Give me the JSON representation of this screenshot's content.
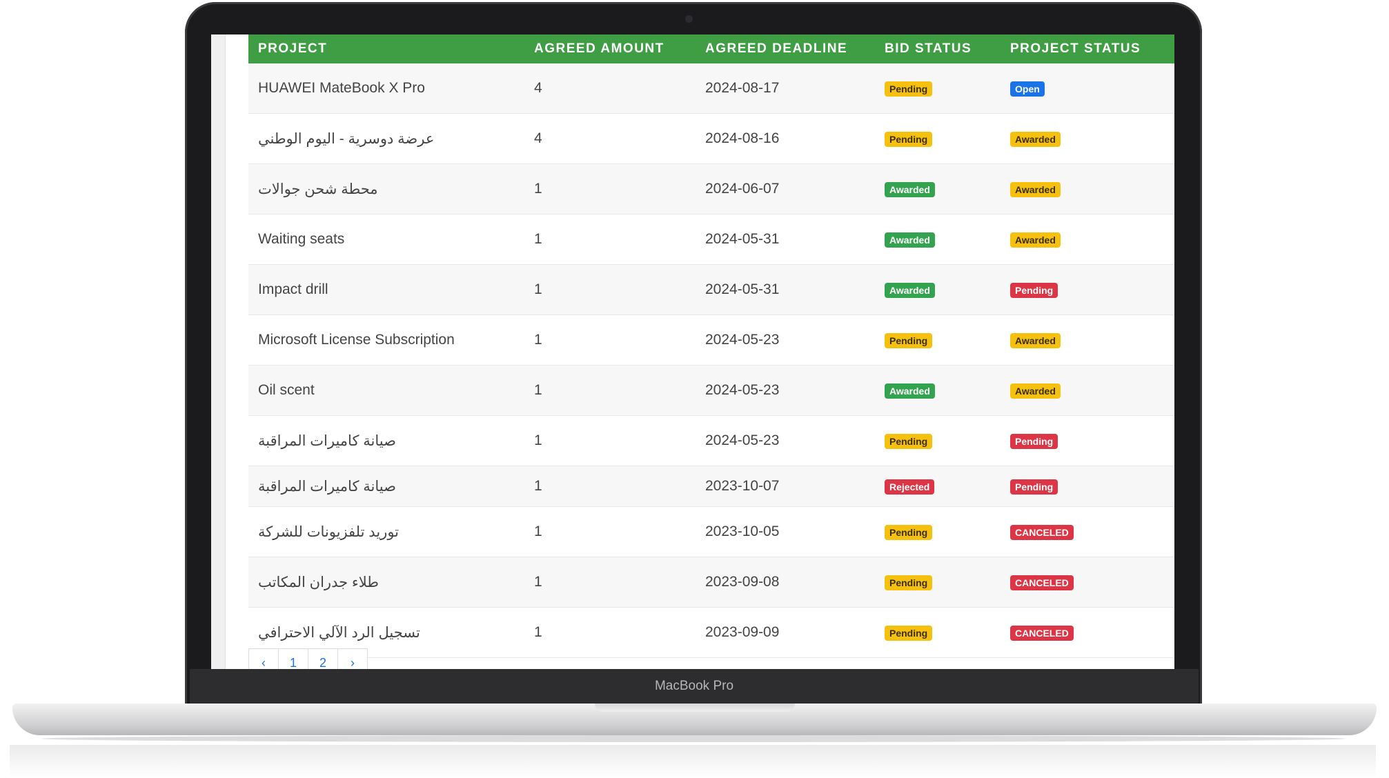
{
  "table": {
    "headers": [
      "PROJECT",
      "AGREED AMOUNT",
      "AGREED DEADLINE",
      "BID STATUS",
      "PROJECT STATUS"
    ],
    "rows": [
      {
        "project": "HUAWEI MateBook X Pro",
        "amount": "4",
        "deadline": "2024-08-17",
        "bid": "Pending",
        "bid_style": "pending-y",
        "status": "Open",
        "status_style": "open-b"
      },
      {
        "project": "عرضة دوسرية - اليوم الوطني",
        "amount": "4",
        "deadline": "2024-08-16",
        "bid": "Pending",
        "bid_style": "pending-y",
        "status": "Awarded",
        "status_style": "awarded-y"
      },
      {
        "project": "محطة شحن جوالات",
        "amount": "1",
        "deadline": "2024-06-07",
        "bid": "Awarded",
        "bid_style": "awarded-g",
        "status": "Awarded",
        "status_style": "awarded-y"
      },
      {
        "project": "Waiting seats",
        "amount": "1",
        "deadline": "2024-05-31",
        "bid": "Awarded",
        "bid_style": "awarded-g",
        "status": "Awarded",
        "status_style": "awarded-y"
      },
      {
        "project": "Impact drill",
        "amount": "1",
        "deadline": "2024-05-31",
        "bid": "Awarded",
        "bid_style": "awarded-g",
        "status": "Pending",
        "status_style": "pending-r"
      },
      {
        "project": "Microsoft License Subscription",
        "amount": "1",
        "deadline": "2024-05-23",
        "bid": "Pending",
        "bid_style": "pending-y",
        "status": "Awarded",
        "status_style": "awarded-y"
      },
      {
        "project": "Oil scent",
        "amount": "1",
        "deadline": "2024-05-23",
        "bid": "Awarded",
        "bid_style": "awarded-g",
        "status": "Awarded",
        "status_style": "awarded-y"
      },
      {
        "project": "صيانة كاميرات المراقبة",
        "amount": "1",
        "deadline": "2024-05-23",
        "bid": "Pending",
        "bid_style": "pending-y",
        "status": "Pending",
        "status_style": "pending-r"
      },
      {
        "project": "صيانة كاميرات المراقبة",
        "amount": "1",
        "deadline": "2023-10-07",
        "bid": "Rejected",
        "bid_style": "rejected-r",
        "status": "Pending",
        "status_style": "pending-r"
      },
      {
        "project": "توريد تلفزيونات للشركة",
        "amount": "1",
        "deadline": "2023-10-05",
        "bid": "Pending",
        "bid_style": "pending-y",
        "status": "CANCELED",
        "status_style": "canceled-r"
      },
      {
        "project": "طلاء جدران المكاتب",
        "amount": "1",
        "deadline": "2023-09-08",
        "bid": "Pending",
        "bid_style": "pending-y",
        "status": "CANCELED",
        "status_style": "canceled-r"
      },
      {
        "project": "تسجيل الرد الآلي الاحترافي",
        "amount": "1",
        "deadline": "2023-09-09",
        "bid": "Pending",
        "bid_style": "pending-y",
        "status": "CANCELED",
        "status_style": "canceled-r"
      }
    ]
  },
  "pagination": [
    "‹",
    "1",
    "2",
    "›"
  ],
  "device": {
    "brand_label": "MacBook Pro"
  },
  "colors": {
    "header_green": "#3f9e43",
    "pending_yellow": "#f6c10e",
    "awarded_green": "#34a34f",
    "danger_red": "#dc3545",
    "open_blue": "#1b73e8"
  }
}
